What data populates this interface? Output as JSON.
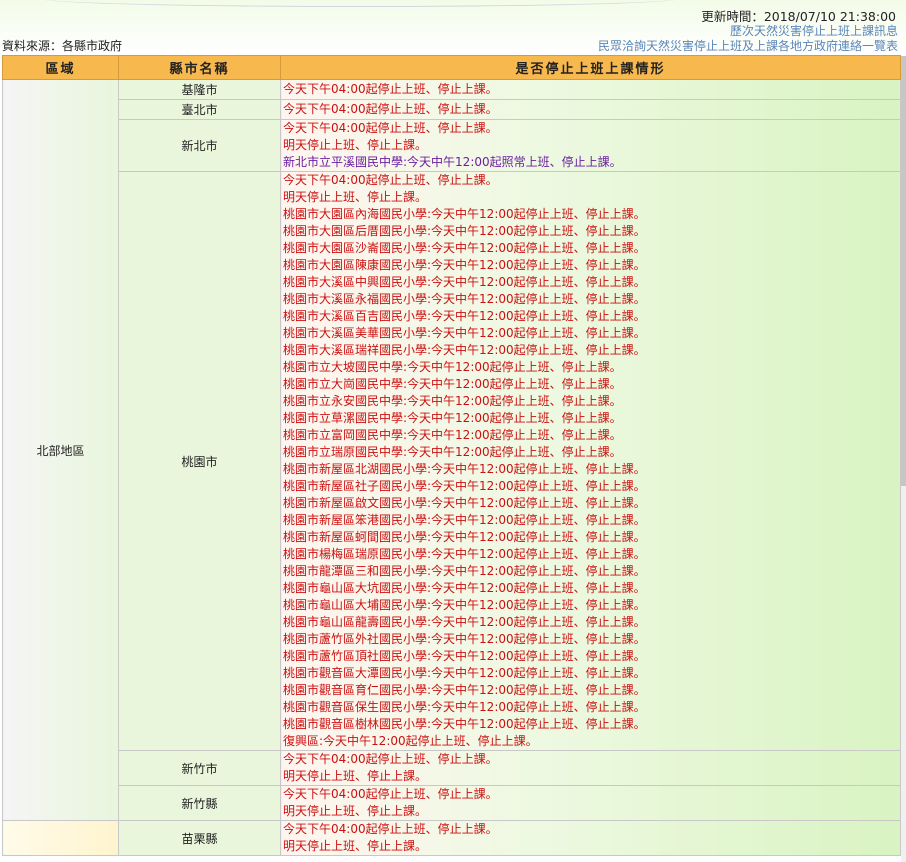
{
  "header": {
    "update_time": "更新時間：2018/07/10 21:38:00",
    "history_link": "歷次天然災害停止上班上課訊息",
    "contacts_link": "民眾洽詢天然災害停止上班及上課各地方政府連絡一覽表",
    "source": "資料來源：各縣市政府"
  },
  "table": {
    "col_region": "區域",
    "col_county": "縣市名稱",
    "col_status": "是否停止上班上課情形",
    "rows": [
      {
        "region": "北部地區",
        "county": "基隆市",
        "lines": [
          "今天下午04:00起停止上班、停止上課。"
        ]
      },
      {
        "region": "",
        "county": "臺北市",
        "lines": [
          "今天下午04:00起停止上班、停止上課。"
        ]
      },
      {
        "region": "",
        "county": "新北市",
        "lines": [
          "今天下午04:00起停止上班、停止上課。",
          "明天停止上班、停止上課。",
          "新北市立平溪國民中學:今天中午12:00起照常上班、停止上課。"
        ]
      },
      {
        "region": "",
        "county": "桃園市",
        "lines": [
          "今天下午04:00起停止上班、停止上課。",
          "明天停止上班、停止上課。",
          "桃園市大園區內海國民小學:今天中午12:00起停止上班、停止上課。",
          "桃園市大園區后厝國民小學:今天中午12:00起停止上班、停止上課。",
          "桃園市大園區沙崙國民小學:今天中午12:00起停止上班、停止上課。",
          "桃園市大園區陳康國民小學:今天中午12:00起停止上班、停止上課。",
          "桃園市大溪區中興國民小學:今天中午12:00起停止上班、停止上課。",
          "桃園市大溪區永福國民小學:今天中午12:00起停止上班、停止上課。",
          "桃園市大溪區百吉國民小學:今天中午12:00起停止上班、停止上課。",
          "桃園市大溪區美華國民小學:今天中午12:00起停止上班、停止上課。",
          "桃園市大溪區瑞祥國民小學:今天中午12:00起停止上班、停止上課。",
          "桃園市立大坡國民中學:今天中午12:00起停止上班、停止上課。",
          "桃園市立大崗國民中學:今天中午12:00起停止上班、停止上課。",
          "桃園市立永安國民中學:今天中午12:00起停止上班、停止上課。",
          "桃園市立草漯國民中學:今天中午12:00起停止上班、停止上課。",
          "桃園市立富岡國民中學:今天中午12:00起停止上班、停止上課。",
          "桃園市立瑞原國民中學:今天中午12:00起停止上班、停止上課。",
          "桃園市新屋區北湖國民小學:今天中午12:00起停止上班、停止上課。",
          "桃園市新屋區社子國民小學:今天中午12:00起停止上班、停止上課。",
          "桃園市新屋區啟文國民小學:今天中午12:00起停止上班、停止上課。",
          "桃園市新屋區笨港國民小學:今天中午12:00起停止上班、停止上課。",
          "桃園市新屋區蚵間國民小學:今天中午12:00起停止上班、停止上課。",
          "桃園市楊梅區瑞原國民小學:今天中午12:00起停止上班、停止上課。",
          "桃園市龍潭區三和國民小學:今天中午12:00起停止上班、停止上課。",
          "桃園市龜山區大坑國民小學:今天中午12:00起停止上班、停止上課。",
          "桃園市龜山區大埔國民小學:今天中午12:00起停止上班、停止上課。",
          "桃園市龜山區龍壽國民小學:今天中午12:00起停止上班、停止上課。",
          "桃園市蘆竹區外社國民小學:今天中午12:00起停止上班、停止上課。",
          "桃園市蘆竹區頂社國民小學:今天中午12:00起停止上班、停止上課。",
          "桃園市觀音區大潭國民小學:今天中午12:00起停止上班、停止上課。",
          "桃園市觀音區育仁國民小學:今天中午12:00起停止上班、停止上課。",
          "桃園市觀音區保生國民小學:今天中午12:00起停止上班、停止上課。",
          "桃園市觀音區樹林國民小學:今天中午12:00起停止上班、停止上課。",
          "復興區:今天中午12:00起停止上班、停止上課。"
        ]
      },
      {
        "region": "",
        "county": "新竹市",
        "lines": [
          "今天下午04:00起停止上班、停止上課。",
          "明天停止上班、停止上課。"
        ]
      },
      {
        "region": "",
        "county": "新竹縣",
        "lines": [
          "今天下午04:00起停止上班、停止上課。",
          "明天停止上班、停止上課。"
        ]
      },
      {
        "region": "",
        "county": "苗栗縣",
        "lines": [
          "今天下午04:00起停止上班、停止上課。",
          "明天停止上班、停止上課。"
        ]
      }
    ]
  },
  "colors": {
    "header_bg": "#f7b84d",
    "alert_text": "#cc1111",
    "normal_text": "#6a1fa0",
    "link": "#5a86b8"
  }
}
